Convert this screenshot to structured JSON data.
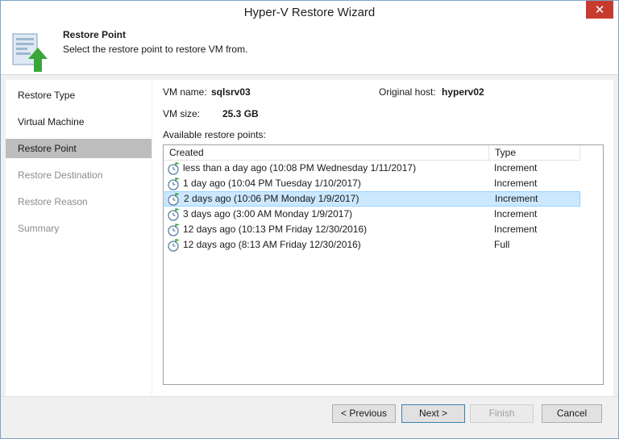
{
  "window": {
    "title": "Hyper-V Restore Wizard",
    "close_glyph": "✕"
  },
  "header": {
    "title": "Restore Point",
    "subtitle": "Select the restore point to restore VM from.",
    "icon": "restore-point-icon"
  },
  "sidebar": {
    "items": [
      {
        "label": "Restore Type",
        "state": "normal"
      },
      {
        "label": "Virtual Machine",
        "state": "normal"
      },
      {
        "label": "Restore Point",
        "state": "active"
      },
      {
        "label": "Restore Destination",
        "state": "disabled"
      },
      {
        "label": "Restore Reason",
        "state": "disabled"
      },
      {
        "label": "Summary",
        "state": "disabled"
      }
    ]
  },
  "vm": {
    "name_label": "VM name:",
    "name_value": "sqlsrv03",
    "size_label": "VM size:",
    "size_value": "25.3 GB",
    "host_label": "Original host:",
    "host_value": "hyperv02"
  },
  "restore_points": {
    "label": "Available restore points:",
    "columns": {
      "created": "Created",
      "type": "Type"
    },
    "rows": [
      {
        "created": "less than a day ago (10:08 PM Wednesday 1/11/2017)",
        "type": "Increment",
        "selected": false
      },
      {
        "created": "1 day ago (10:04 PM Tuesday 1/10/2017)",
        "type": "Increment",
        "selected": false
      },
      {
        "created": "2 days ago (10:06 PM Monday 1/9/2017)",
        "type": "Increment",
        "selected": true
      },
      {
        "created": "3 days ago (3:00 AM Monday 1/9/2017)",
        "type": "Increment",
        "selected": false
      },
      {
        "created": "12 days ago (10:13 PM Friday 12/30/2016)",
        "type": "Increment",
        "selected": false
      },
      {
        "created": "12 days ago (8:13 AM Friday 12/30/2016)",
        "type": "Full",
        "selected": false
      }
    ]
  },
  "buttons": {
    "previous": "< Previous",
    "next": "Next >",
    "finish": "Finish",
    "cancel": "Cancel"
  },
  "colors": {
    "close_button": "#c73b2f",
    "active_nav": "#bdbdbd",
    "selected_row": "#cce8ff",
    "accent_green": "#3aa63a"
  }
}
